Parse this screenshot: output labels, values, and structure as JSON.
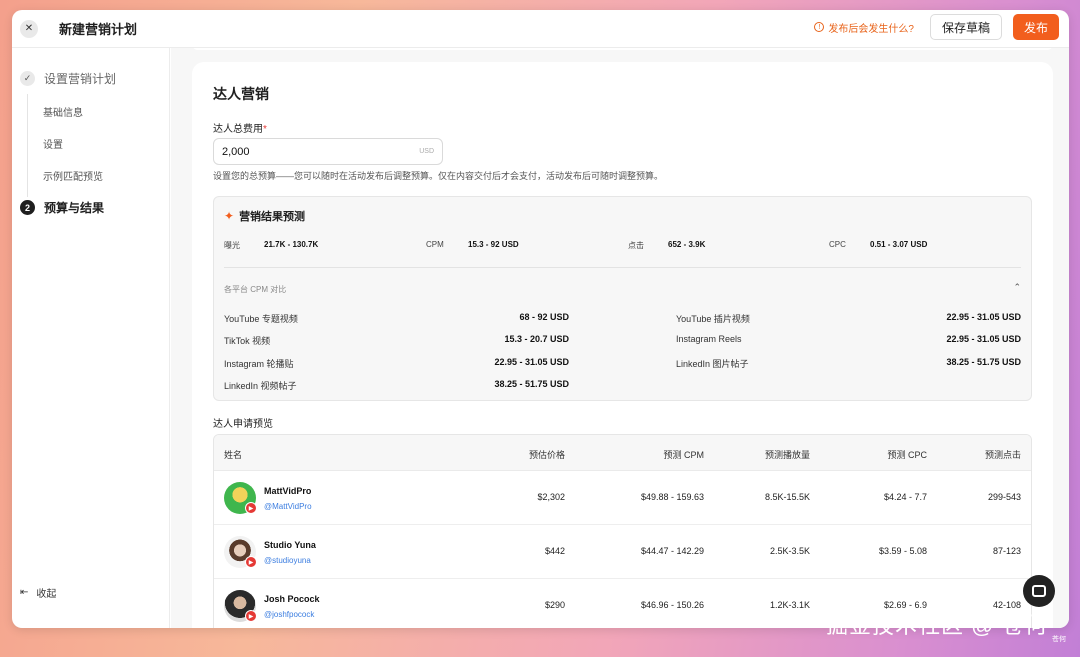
{
  "header": {
    "title": "新建营销计划",
    "hint": "发布后会发生什么?",
    "draft_label": "保存草稿",
    "publish_label": "发布"
  },
  "sidebar": {
    "steps": [
      {
        "label": "设置营销计划",
        "state": "done"
      },
      {
        "label": "预算与结果",
        "number": "2",
        "state": "active"
      }
    ],
    "substeps": [
      "基础信息",
      "设置",
      "示例匹配预览"
    ],
    "collapse_label": "收起"
  },
  "section": {
    "title": "达人营销",
    "budget_label": "达人总费用",
    "budget_required": "*",
    "budget_value": "2,000",
    "budget_unit": "USD",
    "help": "设置您的总预算——您可以随时在活动发布后调整预算。仅在内容交付后才会支付，活动发布后可随时调整预算。"
  },
  "forecast": {
    "title": "营销结果预测",
    "metrics": [
      {
        "label": "曝光",
        "value": "21.7K - 130.7K"
      },
      {
        "label": "CPM",
        "value": "15.3 - 92 USD"
      },
      {
        "label": "点击",
        "value": "652 - 3.9K"
      },
      {
        "label": "CPC",
        "value": "0.51 - 3.07 USD"
      }
    ],
    "compare_label": "各平台 CPM 对比",
    "compare": [
      {
        "name": "YouTube 专题视频",
        "value": "68 - 92 USD"
      },
      {
        "name": "YouTube 插片视频",
        "value": "22.95 - 31.05 USD"
      },
      {
        "name": "TikTok 视频",
        "value": "15.3 - 20.7 USD"
      },
      {
        "name": "Instagram Reels",
        "value": "22.95 - 31.05 USD"
      },
      {
        "name": "Instagram 轮播贴",
        "value": "22.95 - 31.05 USD"
      },
      {
        "name": "LinkedIn 图片帖子",
        "value": "38.25 - 51.75 USD"
      },
      {
        "name": "LinkedIn 视频帖子",
        "value": "38.25 - 51.75 USD"
      }
    ]
  },
  "preview": {
    "label": "达人申请预览",
    "columns": [
      "姓名",
      "预估价格",
      "预测 CPM",
      "预测播放量",
      "预测 CPC",
      "预测点击"
    ],
    "rows": [
      {
        "name": "MattVidPro",
        "handle": "@MattVidPro",
        "price": "$2,302",
        "cpm": "$49.88 - 159.63",
        "views": "8.5K-15.5K",
        "cpc": "$4.24 - 7.7",
        "clicks": "299-543"
      },
      {
        "name": "Studio Yuna",
        "handle": "@studioyuna",
        "price": "$442",
        "cpm": "$44.47 - 142.29",
        "views": "2.5K-3.5K",
        "cpc": "$3.59 - 5.08",
        "clicks": "87-123"
      },
      {
        "name": "Josh Pocock",
        "handle": "@joshfpocock",
        "price": "$290",
        "cpm": "$46.96 - 150.26",
        "views": "1.2K-3.1K",
        "cpc": "$2.69 - 6.9",
        "clicks": "42-108"
      }
    ]
  },
  "watermark": "掘金技术社区 @ 苍何",
  "corner_text": "苍何",
  "colors": {
    "accent": "#f25e1d",
    "link": "#3b7de0"
  }
}
